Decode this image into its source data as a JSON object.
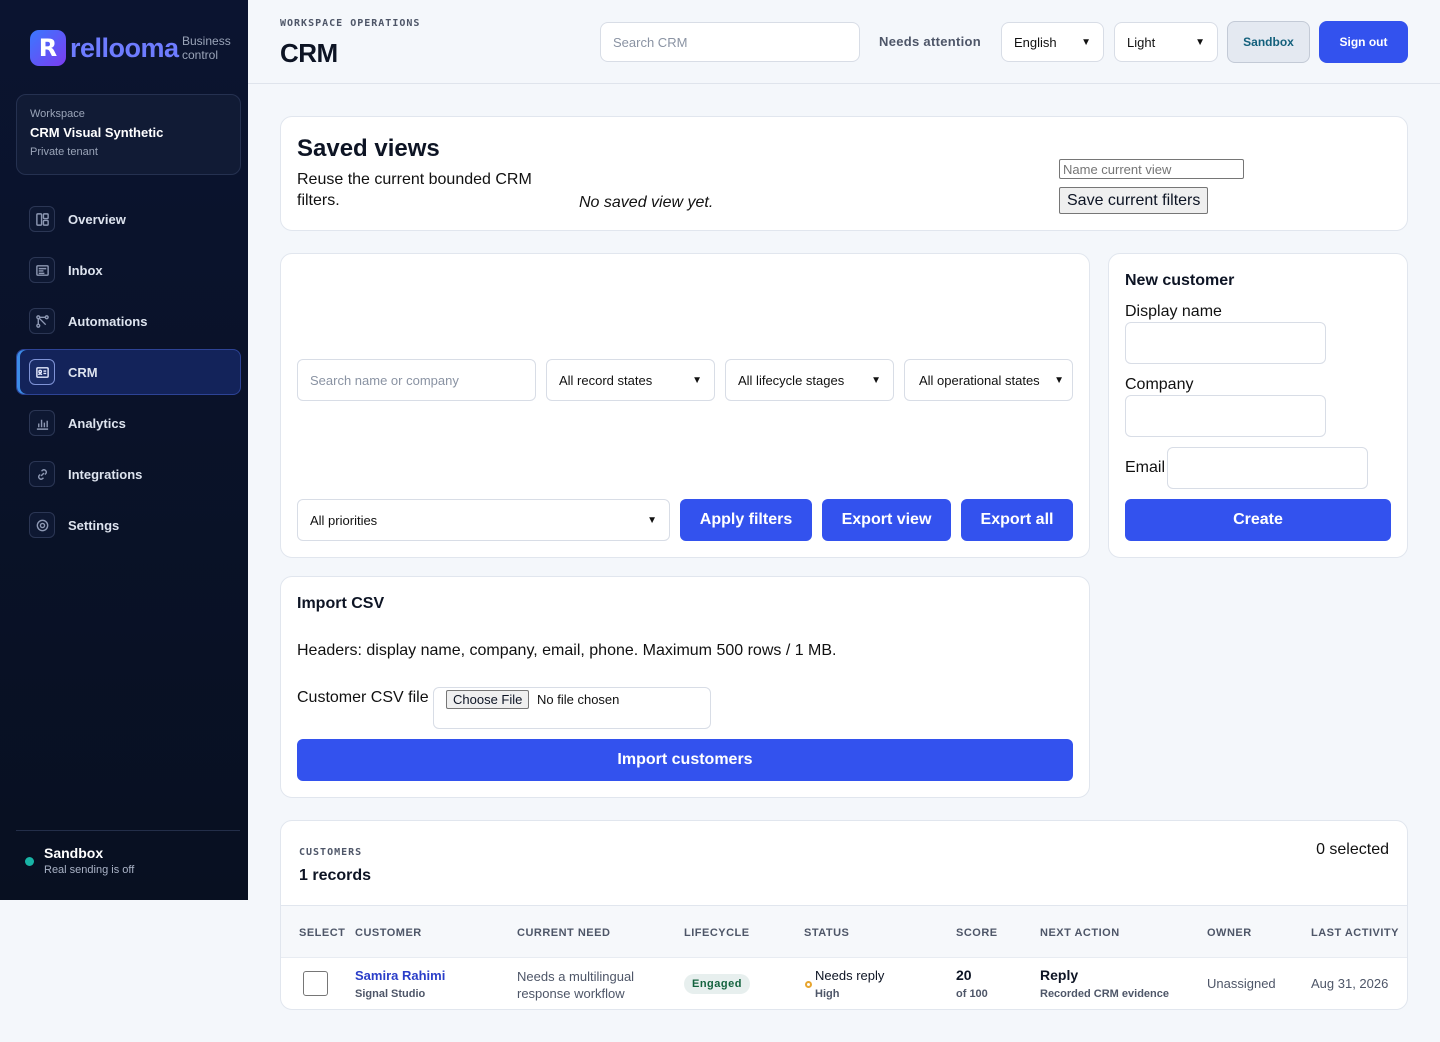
{
  "brand": {
    "mark": "R",
    "name": "rellooma",
    "tagline": "Business control"
  },
  "workspace": {
    "label": "Workspace",
    "name": "CRM Visual Synthetic",
    "sub": "Private tenant"
  },
  "nav": [
    {
      "label": "Overview",
      "icon": "overview-icon"
    },
    {
      "label": "Inbox",
      "icon": "inbox-icon"
    },
    {
      "label": "Automations",
      "icon": "automations-icon"
    },
    {
      "label": "CRM",
      "icon": "crm-icon",
      "active": true
    },
    {
      "label": "Analytics",
      "icon": "analytics-icon"
    },
    {
      "label": "Integrations",
      "icon": "integrations-icon"
    },
    {
      "label": "Settings",
      "icon": "settings-icon"
    }
  ],
  "sidebar_status": {
    "title": "Sandbox",
    "sub": "Real sending is off"
  },
  "header": {
    "eyebrow": "WORKSPACE OPERATIONS",
    "title": "CRM",
    "search_placeholder": "Search CRM",
    "needs_attention": "Needs attention",
    "language": "English",
    "theme": "Light",
    "sandbox": "Sandbox",
    "signout": "Sign out"
  },
  "saved_views": {
    "title": "Saved views",
    "description": "Reuse the current bounded CRM filters.",
    "empty": "No saved view yet.",
    "name_placeholder": "Name current view",
    "save_label": "Save current filters"
  },
  "filters": {
    "search_placeholder": "Search name or company",
    "record_state": "All record states",
    "lifecycle": "All lifecycle stages",
    "operational": "All operational states",
    "priority": "All priorities",
    "apply": "Apply filters",
    "export_view": "Export view",
    "export_all": "Export all"
  },
  "new_customer": {
    "title": "New customer",
    "display_name_label": "Display name",
    "company_label": "Company",
    "email_label": "Email",
    "create": "Create"
  },
  "import_csv": {
    "title": "Import CSV",
    "description": "Headers: display name, company, email, phone. Maximum 500 rows / 1 MB.",
    "file_label": "Customer CSV file",
    "choose": "Choose File",
    "no_file": "No file chosen",
    "submit": "Import customers"
  },
  "customers": {
    "eyebrow": "CUSTOMERS",
    "count": "1 records",
    "selected": "0 selected",
    "columns": [
      "SELECT",
      "CUSTOMER",
      "CURRENT NEED",
      "LIFECYCLE",
      "STATUS",
      "SCORE",
      "NEXT ACTION",
      "OWNER",
      "LAST ACTIVITY"
    ],
    "rows": [
      {
        "name": "Samira Rahimi",
        "company": "Signal Studio",
        "need": "Needs a multilingual response workflow",
        "lifecycle": "Engaged",
        "status": "Needs reply",
        "priority": "High",
        "score": "20",
        "score_of": "of 100",
        "next_action": "Reply",
        "next_action_sub": "Recorded CRM evidence",
        "owner": "Unassigned",
        "last_activity": "Aug 31, 2026"
      }
    ]
  }
}
